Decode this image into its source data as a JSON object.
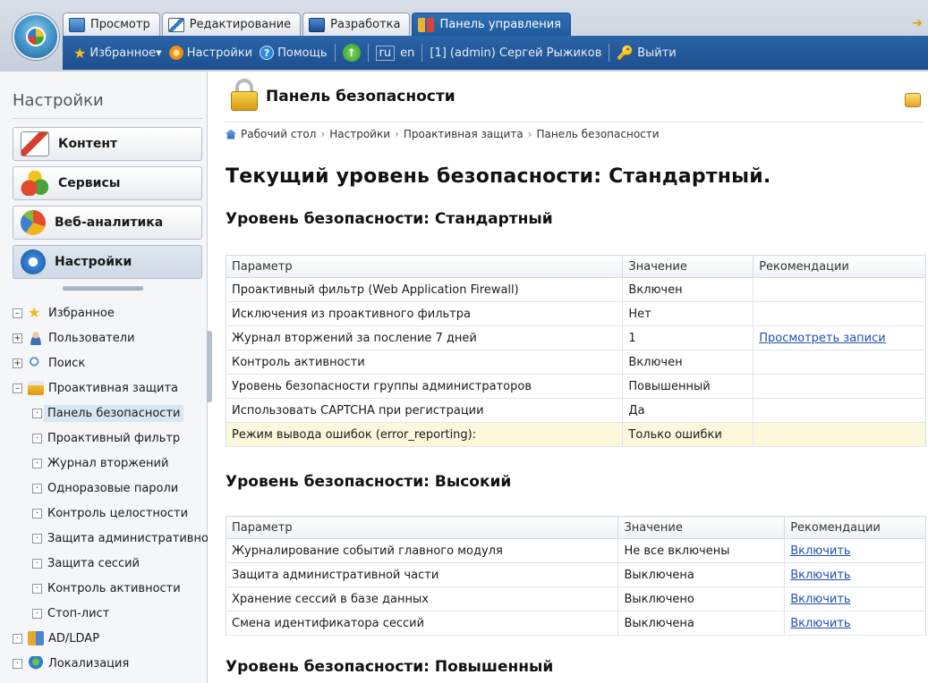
{
  "tabs": [
    {
      "label": "Просмотр",
      "icon": "view-icon"
    },
    {
      "label": "Редактирование",
      "icon": "edit-icon"
    },
    {
      "label": "Разработка",
      "icon": "develop-icon"
    },
    {
      "label": "Панель управления",
      "icon": "control-panel-icon",
      "active": true
    }
  ],
  "toolbar": {
    "favorites": "Избранное",
    "settings": "Настройки",
    "help": "Помощь",
    "lang_ru": "ru",
    "lang_en": "en",
    "user": "[1] (admin) Сергей Рыжиков",
    "logout": "Выйти"
  },
  "sidebar": {
    "title": "Настройки",
    "menu": [
      {
        "label": "Контент",
        "icon": "content-icon"
      },
      {
        "label": "Сервисы",
        "icon": "services-icon"
      },
      {
        "label": "Веб-аналитика",
        "icon": "analytics-icon"
      },
      {
        "label": "Настройки",
        "icon": "settings-icon",
        "active": true
      }
    ],
    "tree": {
      "favorites": "Избранное",
      "users": "Пользователи",
      "search": "Поиск",
      "proactive": "Проактивная защита",
      "children": [
        "Панель безопасности",
        "Проактивный фильтр",
        "Журнал вторжений",
        "Одноразовые пароли",
        "Контроль целостности",
        "Защита административной части",
        "Защита сессий",
        "Контроль активности",
        "Стоп-лист"
      ],
      "ldap": "AD/LDAP",
      "localization": "Локализация"
    }
  },
  "main": {
    "title": "Панель безопасности",
    "breadcrumb": [
      "Рабочий стол",
      "Настройки",
      "Проактивная защита",
      "Панель безопасности"
    ],
    "current_level": "Текущий уровень безопасности: Стандартный.",
    "columns": {
      "param": "Параметр",
      "value": "Значение",
      "rec": "Рекомендации"
    },
    "standard": {
      "heading": "Уровень безопасности: Стандартный",
      "rows": [
        {
          "param": "Проактивный фильтр (Web Application Firewall)",
          "value": "Включен",
          "rec": ""
        },
        {
          "param": "Исключения из проактивного фильтра",
          "value": "Нет",
          "rec": ""
        },
        {
          "param": "Журнал вторжений за послениe 7 дней",
          "value": "1",
          "rec": "Просмотреть записи"
        },
        {
          "param": "Контроль активности",
          "value": "Включен",
          "rec": ""
        },
        {
          "param": "Уровень безопасности группы администраторов",
          "value": "Повышенный",
          "rec": ""
        },
        {
          "param": "Использовать CAPTCHA при регистрации",
          "value": "Да",
          "rec": ""
        },
        {
          "param": "Режим вывода ошибок (error_reporting):",
          "value": "Только ошибки",
          "rec": "",
          "highlight": true
        }
      ]
    },
    "high": {
      "heading": "Уровень безопасности: Высокий",
      "rows": [
        {
          "param": "Журналирование событий главного модуля",
          "value": "Не все включены",
          "rec": "Включить"
        },
        {
          "param": "Защита административной части",
          "value": "Выключена",
          "rec": "Включить"
        },
        {
          "param": "Хранение сессий в базе данных",
          "value": "Выключено",
          "rec": "Включить"
        },
        {
          "param": "Смена идентификатора сессий",
          "value": "Выключена",
          "rec": "Включить"
        }
      ]
    },
    "elevated": {
      "heading": "Уровень безопасности: Повышенный"
    }
  }
}
